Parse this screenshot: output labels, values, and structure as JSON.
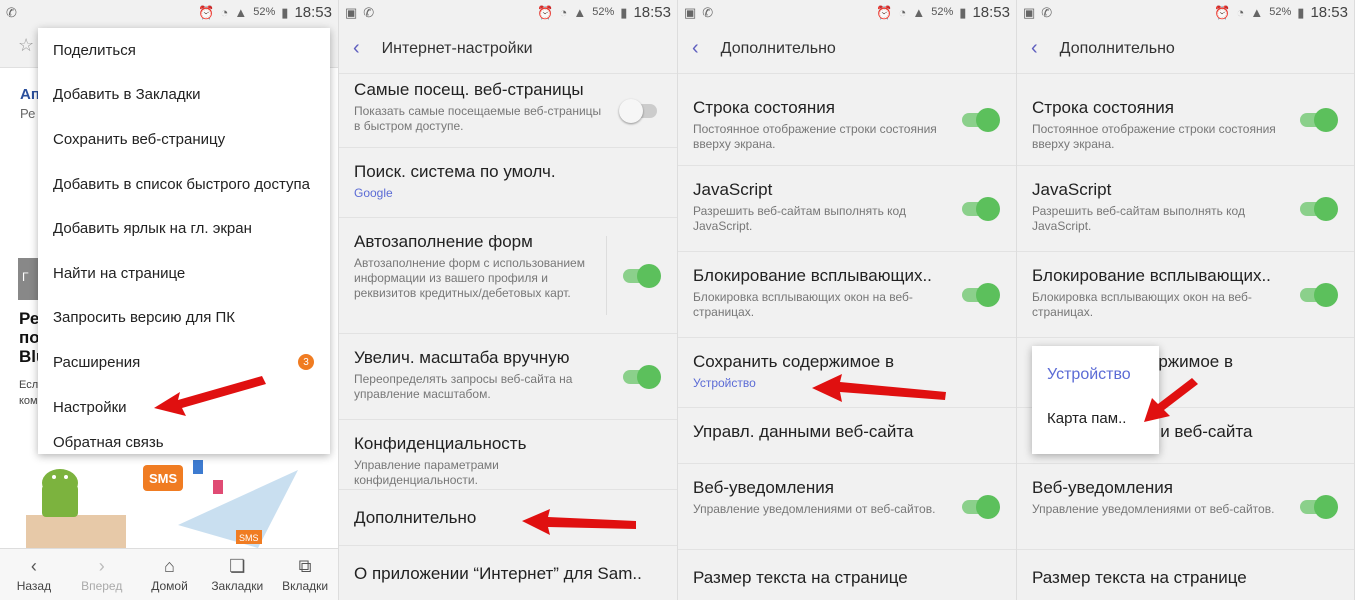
{
  "status": {
    "battery": "52%",
    "time": "18:53"
  },
  "panel1": {
    "peek": {
      "a": "Ап",
      "b": "Ре",
      "c": "Ре",
      "d": "по",
      "e": "Blu",
      "f": "Есл",
      "g": "ком",
      "h": "Г"
    },
    "menu": [
      "Поделиться",
      "Добавить в Закладки",
      "Сохранить веб-страницу",
      "Добавить в список быстрого доступа",
      "Добавить ярлык на гл. экран",
      "Найти на странице",
      "Запросить версию для ПК",
      "Расширения",
      "Настройки",
      "Обратная связь"
    ],
    "ext_badge": "3",
    "bottom": {
      "back": "Назад",
      "forward": "Вперед",
      "home": "Домой",
      "bookmarks": "Закладки",
      "tabs": "Вкладки"
    },
    "sms1": "SMS",
    "sms2": "SMS"
  },
  "panel2": {
    "title": "Интернет-настройки",
    "rows": [
      {
        "t": "Самые посещ. веб-страницы",
        "s": "Показать самые посещаемые веб-страницы в быстром доступе."
      },
      {
        "t": "Поиск. система по умолч.",
        "s": "Google"
      },
      {
        "t": "Автозаполнение форм",
        "s": "Автозаполнение форм с использованием информации из вашего профиля и реквизитов кредитных/дебетовых карт."
      },
      {
        "t": "Увелич. масштаба вручную",
        "s": "Переопределять запросы веб-сайта на управление масштабом."
      },
      {
        "t": "Конфиденциальность",
        "s": "Управление параметрами конфиденциальности."
      },
      {
        "t": "Дополнительно"
      },
      {
        "t": "О приложении “Интернет” для Sam.."
      }
    ]
  },
  "panel3": {
    "title": "Дополнительно",
    "rows": [
      {
        "t": "Строка состояния",
        "s": "Постоянное отображение строки состояния вверху экрана."
      },
      {
        "t": "JavaScript",
        "s": "Разрешить веб-сайтам выполнять код JavaScript."
      },
      {
        "t": "Блокирование всплывающих..",
        "s": "Блокировка всплывающих окон на веб-страницах."
      },
      {
        "t": "Сохранить содержимое в",
        "s": "Устройство"
      },
      {
        "t": "Управл. данными веб-сайта"
      },
      {
        "t": "Веб-уведомления",
        "s": "Управление уведомлениями от веб-сайтов."
      },
      {
        "t": "Размер текста на странице"
      }
    ]
  },
  "panel4": {
    "title": "Дополнительно",
    "rows": [
      {
        "t": "Строка состояния",
        "s": "Постоянное отображение строки состояния вверху экрана."
      },
      {
        "t": "JavaScript",
        "s": "Разрешить веб-сайтам выполнять код JavaScript."
      },
      {
        "t": "Блокирование всплывающих..",
        "s": "Блокировка всплывающих окон на веб-страницах."
      },
      {
        "t": "Сохранить содержимое в",
        "s": ""
      },
      {
        "t": "Управл. данными веб-сайта"
      },
      {
        "t": "Веб-уведомления",
        "s": "Управление уведомлениями от веб-сайтов."
      },
      {
        "t": "Размер текста на странице"
      }
    ],
    "popup": {
      "opt1": "Устройство",
      "opt2": "Карта пам.."
    }
  },
  "colors": {
    "accent": "#5b6bd5",
    "toggle_on": "#5cc05c",
    "arrow": "#e01010",
    "badge": "#f07c22"
  }
}
